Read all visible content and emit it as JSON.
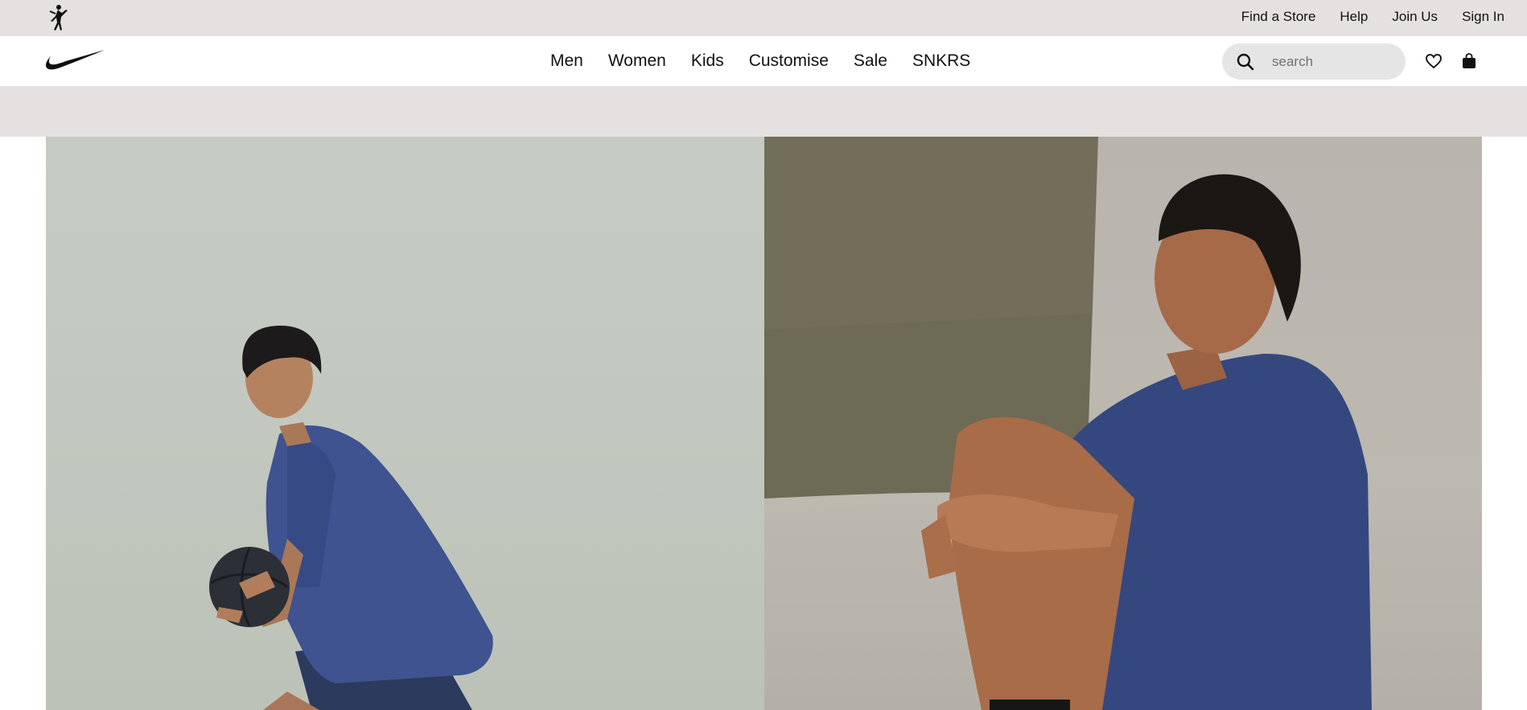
{
  "utility_bar": {
    "links": [
      "Find a Store",
      "Help",
      "Join Us",
      "Sign In"
    ]
  },
  "header": {
    "nav": [
      "Men",
      "Women",
      "Kids",
      "Customise",
      "Sale",
      "SNKRS"
    ],
    "search": {
      "placeholder": "search",
      "value": ""
    },
    "icons": {
      "brand_secondary": "jordan-jumpman-icon",
      "brand": "nike-swoosh-icon",
      "search": "search-icon",
      "favourites": "heart-icon",
      "bag": "bag-icon"
    }
  },
  "hero": {
    "panels": [
      {
        "name": "athlete-with-basketball-image"
      },
      {
        "name": "athlete-stretching-image"
      }
    ]
  },
  "colors": {
    "utility_bg": "#e5e1e1",
    "header_bg": "#ffffff",
    "search_bg": "#e5e5e5",
    "text": "#111111",
    "shirt_blue": "#3a4f8a"
  }
}
